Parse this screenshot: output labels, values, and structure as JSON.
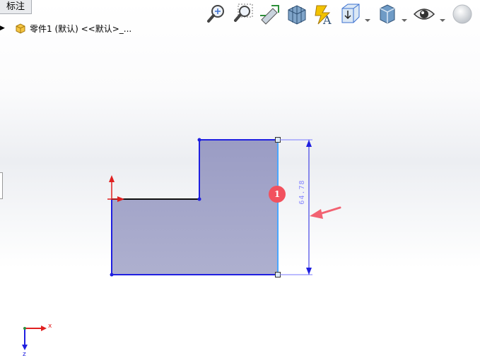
{
  "panel_tab": {
    "label": "标注"
  },
  "feature_tree": {
    "part_label": "零件1 (默认) <<默认>_..."
  },
  "dimension": {
    "value_text": "64.78"
  },
  "callout": {
    "number": "1"
  },
  "axes": {
    "x_label": "x",
    "z_label": "z"
  },
  "toolbar": {
    "icons": [
      "zoom-to-fit-icon",
      "zoom-to-area-icon",
      "previous-view-icon",
      "section-view-icon",
      "dynamic-annotation-icon",
      "view-orientation-icon",
      "display-style-icon",
      "hide-show-items-icon",
      "edit-appearance-icon"
    ]
  },
  "colors": {
    "sketch_line": "#1f1fe0",
    "fill": "#9fa3c8",
    "selected_edge": "#4aa6ff",
    "dimension": "#7a7aff",
    "badge": "#f2515e",
    "arrow": "#f26272"
  }
}
